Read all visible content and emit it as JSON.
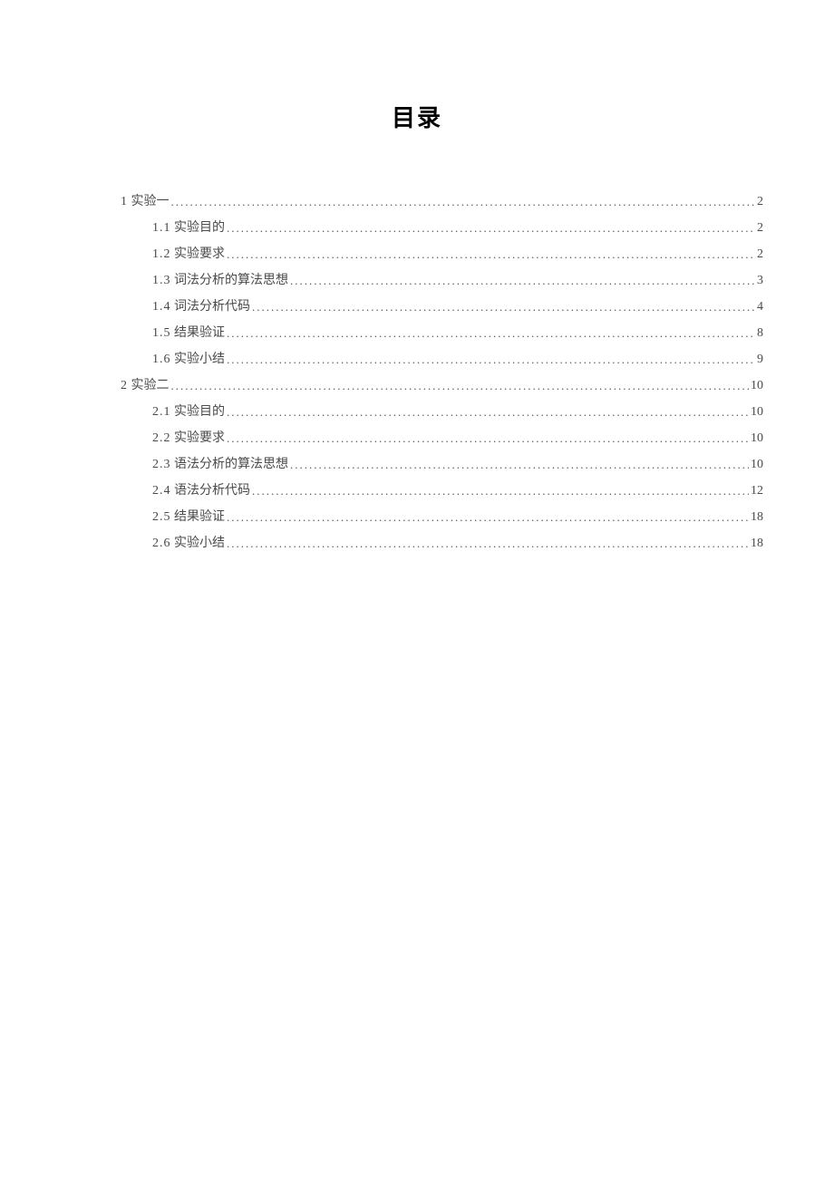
{
  "title": "目录",
  "toc": [
    {
      "level": 1,
      "num": "1",
      "label": "实验一",
      "page": "2"
    },
    {
      "level": 2,
      "num": "1.1",
      "label": "实验目的",
      "page": "2"
    },
    {
      "level": 2,
      "num": "1.2",
      "label": "实验要求",
      "page": "2"
    },
    {
      "level": 2,
      "num": "1.3",
      "label": "词法分析的算法思想",
      "page": "3"
    },
    {
      "level": 2,
      "num": "1.4",
      "label": "词法分析代码",
      "page": "4"
    },
    {
      "level": 2,
      "num": "1.5",
      "label": "结果验证",
      "page": "8"
    },
    {
      "level": 2,
      "num": "1.6",
      "label": "实验小结",
      "page": "9"
    },
    {
      "level": 1,
      "num": "2",
      "label": "实验二",
      "page": "10"
    },
    {
      "level": 2,
      "num": "2.1",
      "label": "实验目的",
      "page": "10"
    },
    {
      "level": 2,
      "num": "2.2",
      "label": "实验要求",
      "page": "10"
    },
    {
      "level": 2,
      "num": "2.3",
      "label": "语法分析的算法思想",
      "page": "10"
    },
    {
      "level": 2,
      "num": "2.4",
      "label": "语法分析代码",
      "page": "12"
    },
    {
      "level": 2,
      "num": "2.5",
      "label": "结果验证",
      "page": "18"
    },
    {
      "level": 2,
      "num": "2.6",
      "label": "实验小结",
      "page": "18"
    }
  ]
}
